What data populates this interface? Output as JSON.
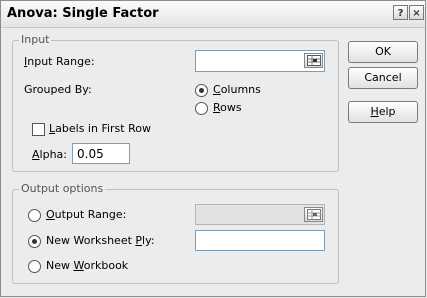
{
  "window": {
    "title": "Anova: Single Factor",
    "help_icon_glyph": "?",
    "close_icon_glyph": "×"
  },
  "input": {
    "group_label": "Input",
    "input_range": {
      "label": "Input Range:",
      "mnemonic": "I",
      "label_rest": "nput Range:",
      "value": ""
    },
    "grouped_by": {
      "label": "Grouped By:",
      "columns": {
        "mnemonic": "C",
        "rest": "olumns",
        "checked": true
      },
      "rows": {
        "mnemonic": "R",
        "rest": "ows",
        "checked": false
      }
    },
    "labels_first_row": {
      "mnemonic": "L",
      "rest": "abels in First Row",
      "checked": false
    },
    "alpha": {
      "mnemonic": "A",
      "rest": "lpha:",
      "value": "0.05"
    }
  },
  "output": {
    "group_label": "Output options",
    "output_range": {
      "mnemonic": "O",
      "rest": "utput Range:",
      "checked": false,
      "value": "",
      "disabled": true
    },
    "new_worksheet_ply": {
      "before": "New Worksheet ",
      "mnemonic": "P",
      "rest": "ly:",
      "checked": true,
      "value": ""
    },
    "new_workbook": {
      "before": "New ",
      "mnemonic": "W",
      "rest": "orkbook",
      "checked": false
    }
  },
  "buttons": {
    "ok": "OK",
    "cancel": "Cancel",
    "help": {
      "mnemonic": "H",
      "rest": "elp"
    }
  }
}
